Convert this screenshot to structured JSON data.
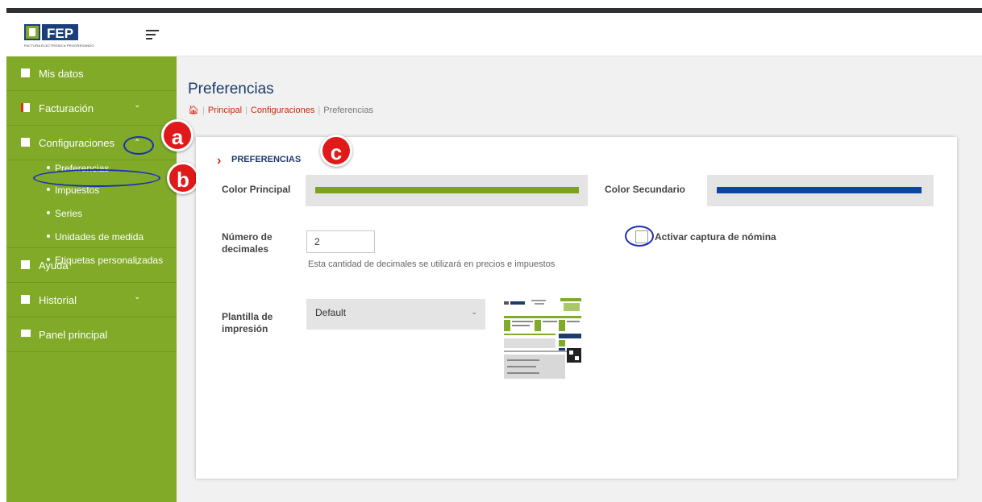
{
  "app": {
    "logo_text": "FEP",
    "logo_subtitle": "FACTURA ELECTRÓNICA PROGRESANDO"
  },
  "sidebar": {
    "items": [
      {
        "label": "Mis datos",
        "icon": "user-card-icon"
      },
      {
        "label": "Facturación",
        "icon": "invoice-icon",
        "chevron": "⌄"
      },
      {
        "label": "Configuraciones",
        "icon": "gear-icon",
        "chevron": "⌃"
      },
      {
        "label": "Ayuda",
        "icon": "help-icon",
        "chevron": "⌄"
      },
      {
        "label": "Historial",
        "icon": "search-icon",
        "chevron": "⌄"
      },
      {
        "label": "Panel principal",
        "icon": "monitor-icon"
      }
    ],
    "submenu": [
      {
        "label": "Preferencias"
      },
      {
        "label": "Impuestos"
      },
      {
        "label": "Series"
      },
      {
        "label": "Unidades de medida"
      },
      {
        "label": "Etiquetas personalizadas"
      }
    ]
  },
  "annotations": {
    "a": "a",
    "b": "b",
    "c": "c"
  },
  "page": {
    "title": "Preferencias",
    "breadcrumb": {
      "principal": "Principal",
      "configuraciones": "Configuraciones",
      "current": "Preferencias"
    }
  },
  "form": {
    "section_title": "PREFERENCIAS",
    "color_principal_label": "Color Principal",
    "color_principal": "#7aa21b",
    "color_secundario_label": "Color Secundario",
    "color_secundario": "#0d47a1",
    "decimales_label_1": "Número de",
    "decimales_label_2": "decimales",
    "decimales_value": "2",
    "decimales_hint": "Esta cantidad de decimales se utilizará en precios e impuestos",
    "nomina_label": "Activar captura de nómina",
    "nomina_checked": false,
    "plantilla_label_1": "Plantilla de",
    "plantilla_label_2": "impresión",
    "plantilla_value": "Default"
  },
  "colors": {
    "sidebar": "#80aa28",
    "accent_red": "#c42b12",
    "title_blue": "#1d3b6b",
    "annotation_blue": "#1a2fb8",
    "badge_red": "#e01a1a"
  }
}
